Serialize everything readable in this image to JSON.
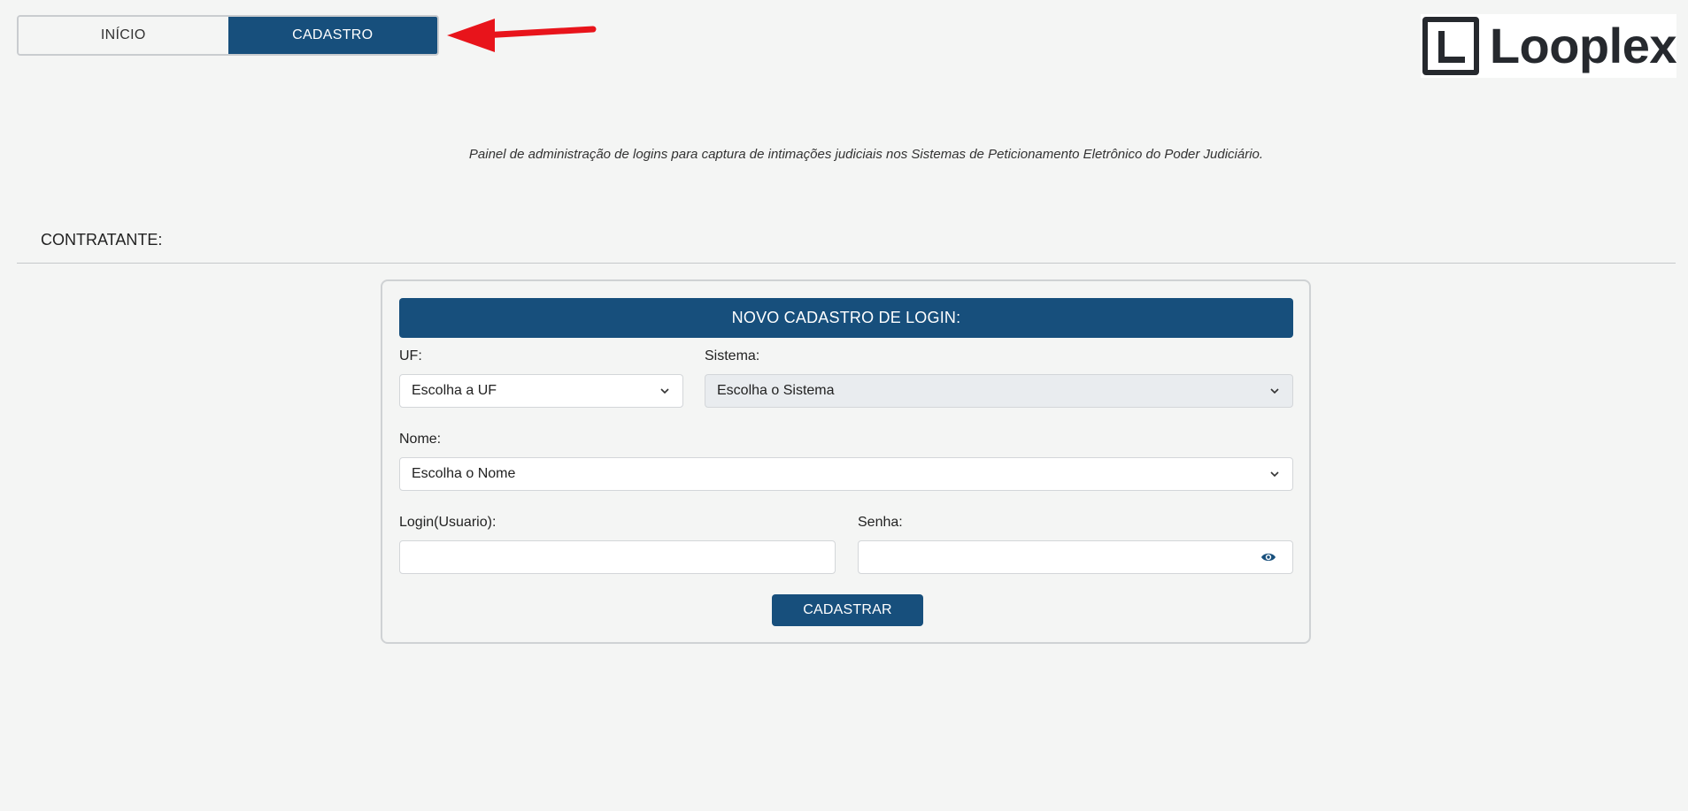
{
  "nav": {
    "tabs": [
      {
        "label": "INÍCIO",
        "active": false
      },
      {
        "label": "CADASTRO",
        "active": true
      }
    ]
  },
  "logo": {
    "text": "Looplex"
  },
  "subtitle": "Painel de administração de logins para captura de intimações judiciais nos Sistemas de Peticionamento Eletrônico do Poder Judiciário.",
  "contratante_label": "CONTRATANTE:",
  "form": {
    "title": "NOVO CADASTRO DE LOGIN:",
    "uf": {
      "label": "UF:",
      "selected": "Escolha a UF"
    },
    "sistema": {
      "label": "Sistema:",
      "selected": "Escolha o Sistema",
      "disabled": true
    },
    "nome": {
      "label": "Nome:",
      "selected": "Escolha o Nome"
    },
    "login": {
      "label": "Login(Usuario):",
      "value": ""
    },
    "senha": {
      "label": "Senha:",
      "value": ""
    },
    "submit_label": "CADASTRAR"
  },
  "colors": {
    "primary": "#174f7c",
    "background": "#f4f5f4",
    "annotation_arrow": "#e8141b"
  },
  "icons": {
    "select_chevron": "chevron-down-icon",
    "password_toggle": "eye-icon",
    "annotation": "red-arrow-icon"
  }
}
